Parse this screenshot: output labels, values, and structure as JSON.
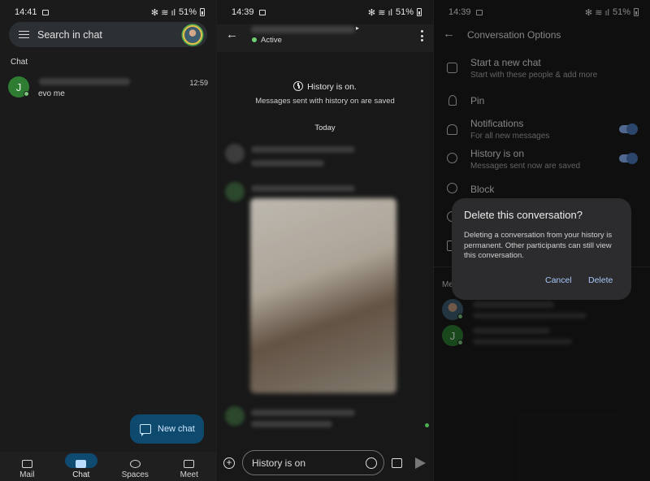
{
  "panel1": {
    "status": {
      "time": "14:41",
      "battery": "51%"
    },
    "search": {
      "placeholder": "Search in chat"
    },
    "section_label": "Chat",
    "chats": [
      {
        "avatar_letter": "J",
        "time": "12:59",
        "preview": "evo me"
      }
    ],
    "fab": {
      "label": "New chat"
    },
    "nav": [
      {
        "label": "Mail",
        "icon": "mail-icon",
        "active": false
      },
      {
        "label": "Chat",
        "icon": "chat-icon",
        "active": true
      },
      {
        "label": "Spaces",
        "icon": "spaces-icon",
        "active": false
      },
      {
        "label": "Meet",
        "icon": "video-icon",
        "active": false
      }
    ]
  },
  "panel2": {
    "status": {
      "time": "14:39",
      "battery": "51%"
    },
    "header": {
      "presence": "Active"
    },
    "history": {
      "title": "History is on.",
      "subtitle": "Messages sent with history on are saved"
    },
    "date_divider": "Today",
    "composer": {
      "placeholder": "History is on"
    }
  },
  "panel3": {
    "status": {
      "time": "14:39",
      "battery": "51%"
    },
    "title": "Conversation Options",
    "options": [
      {
        "title": "Start a new chat",
        "subtitle": "Start with these people & add more",
        "icon": "new-chat-icon"
      },
      {
        "title": "Pin",
        "subtitle": "",
        "icon": "pin-icon"
      },
      {
        "title": "Notifications",
        "subtitle": "For all new messages",
        "icon": "bell-icon",
        "toggle": true
      },
      {
        "title": "History is on",
        "subtitle": "Messages sent now are saved",
        "icon": "history-icon",
        "toggle": true
      },
      {
        "title": "Block",
        "subtitle": "",
        "icon": "block-icon"
      }
    ],
    "members_label": "Me",
    "members": [
      {
        "avatar": "photo"
      },
      {
        "avatar_letter": "J"
      }
    ],
    "dialog": {
      "title": "Delete this conversation?",
      "body": "Deleting a conversation from your history is permanent. Other participants can still view this conversation.",
      "cancel": "Cancel",
      "confirm": "Delete"
    }
  },
  "colors": {
    "background": "#1b1b1b",
    "accent": "#a8c7fa",
    "active_green": "#6fcf73",
    "fab": "#0e4a6e",
    "toggle_on": "#8ab4f8"
  }
}
